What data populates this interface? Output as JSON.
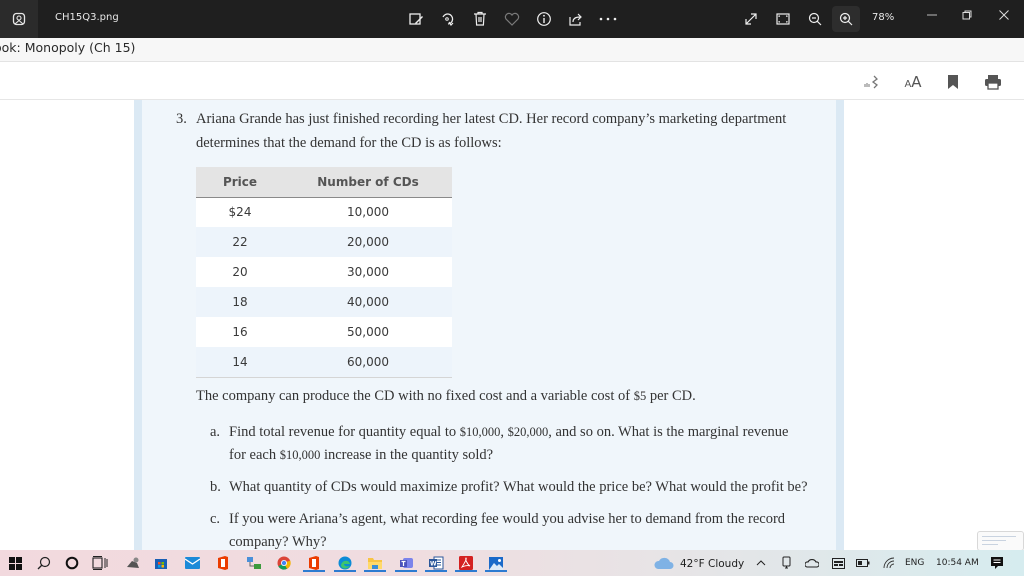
{
  "window": {
    "title": "CH15Q3.png",
    "zoom_level": "78%",
    "icons": [
      "edit-image-icon",
      "rotate-icon",
      "delete-icon",
      "favorite-heart-icon",
      "info-icon",
      "share-icon",
      "more-icon",
      "fullscreen-icon",
      "fit-window-icon",
      "zoom-out-icon",
      "zoom-in-icon"
    ]
  },
  "document": {
    "breadcrumb": "ook: Monopoly (Ch 15)",
    "reader_tools": {
      "text_size_label": "AA",
      "icons": [
        "read-aloud-icon",
        "text-size-icon",
        "bookmark-icon",
        "print-icon"
      ]
    }
  },
  "question": {
    "number": "3.",
    "line1": "Ariana Grande has just finished recording her latest CD. Her record company’s marketing department",
    "line2": "determines that the demand for the CD is as follows:",
    "table": {
      "headers": [
        "Price",
        "Number of CDs"
      ],
      "rows": [
        [
          "$24",
          "10,000"
        ],
        [
          "22",
          "20,000"
        ],
        [
          "20",
          "30,000"
        ],
        [
          "18",
          "40,000"
        ],
        [
          "16",
          "50,000"
        ],
        [
          "14",
          "60,000"
        ]
      ]
    },
    "cost_text_pre": "The company can produce the CD with no fixed cost and a variable cost of ",
    "cost_value": "$5",
    "cost_text_post": " per CD.",
    "parts": [
      {
        "label": "a.",
        "line1_pre": "Find total revenue for quantity equal to ",
        "line1_v1": "$10,000",
        "line1_mid": ", ",
        "line1_v2": "$20,000",
        "line1_post": ", and so on. What is the marginal revenue",
        "line2_pre": "for each ",
        "line2_v": "$10,000",
        "line2_post": " increase in the quantity sold?"
      },
      {
        "label": "b.",
        "line1": "What quantity of CDs would maximize profit? What would the price be? What would the profit be?"
      },
      {
        "label": "c.",
        "line1": "If you were Ariana’s agent, what recording fee would you advise her to demand from the record",
        "line2": "company? Why?"
      }
    ]
  },
  "taskbar": {
    "apps": [
      "start",
      "search",
      "cortana",
      "task-view",
      "scanner",
      "microsoft-store",
      "mail",
      "office",
      "network-app",
      "chrome",
      "office-2",
      "edge",
      "file-explorer",
      "teams",
      "word",
      "acrobat",
      "photos"
    ],
    "weather": "42°F  Cloudy",
    "language": "ENG",
    "time": "10:54 AM"
  }
}
